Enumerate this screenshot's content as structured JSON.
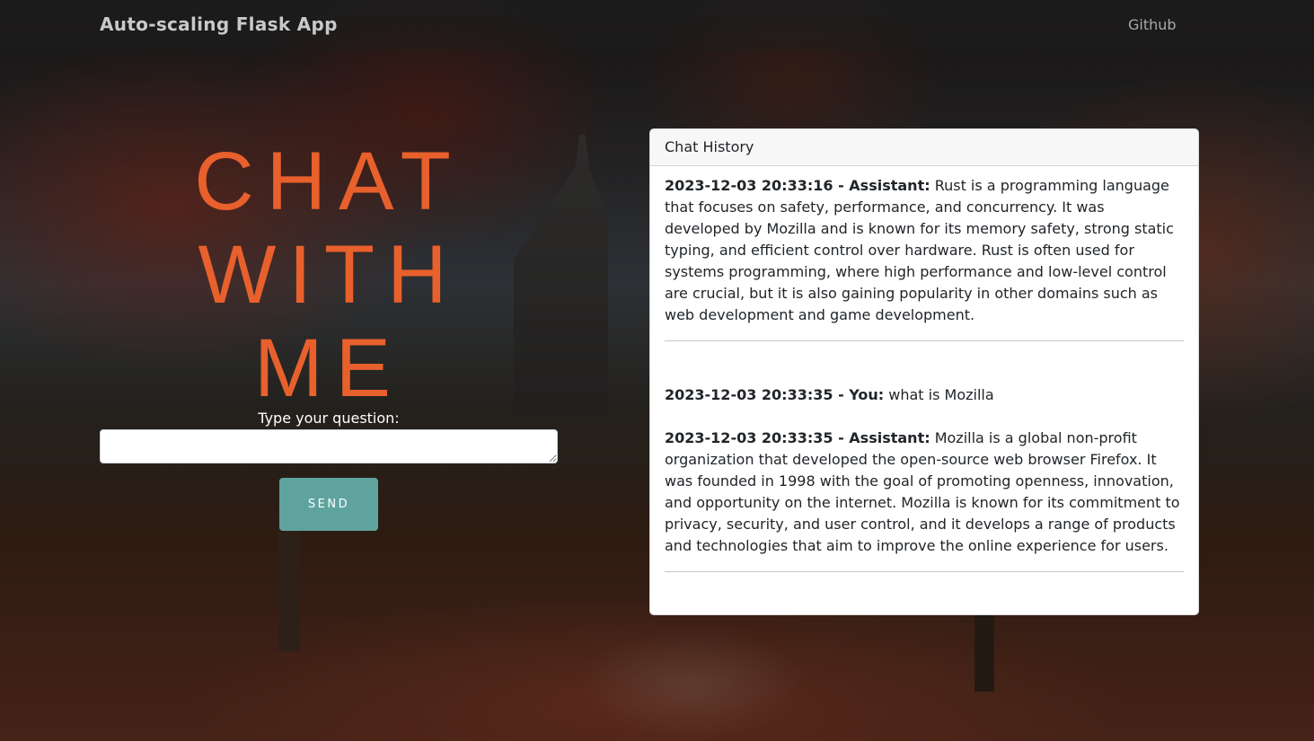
{
  "navbar": {
    "brand": "Auto-scaling Flask App",
    "links": [
      {
        "label": "Github"
      }
    ]
  },
  "hero": {
    "title_lines": [
      "CHAT",
      "WITH",
      "ME"
    ],
    "title_color": "#e8602c"
  },
  "form": {
    "label": "Type your question:",
    "input_value": "",
    "send_label": "SEND",
    "send_color": "#5fa39e"
  },
  "chat": {
    "header": "Chat History",
    "messages": [
      {
        "timestamp": "2023-12-03 20:33:16",
        "prefix": "2023-12-03 20:33:16 - Assistant:",
        "sender": "Assistant",
        "text": " Rust is a programming language that focuses on safety, performance, and concurrency. It was developed by Mozilla and is known for its memory safety, strong static typing, and efficient control over hardware. Rust is often used for systems programming, where high performance and low-level control are crucial, but it is also gaining popularity in other domains such as web development and game development."
      },
      {
        "timestamp": "2023-12-03 20:33:35",
        "prefix": "2023-12-03 20:33:35 - You:",
        "sender": "You",
        "text": " what is Mozilla"
      },
      {
        "timestamp": "2023-12-03 20:33:35",
        "prefix": "2023-12-03 20:33:35 - Assistant:",
        "sender": "Assistant",
        "text": " Mozilla is a global non-profit organization that developed the open-source web browser Firefox. It was founded in 1998 with the goal of promoting openness, innovation, and opportunity on the internet. Mozilla is known for its commitment to privacy, security, and user control, and it develops a range of products and technologies that aim to improve the online experience for users."
      }
    ]
  }
}
